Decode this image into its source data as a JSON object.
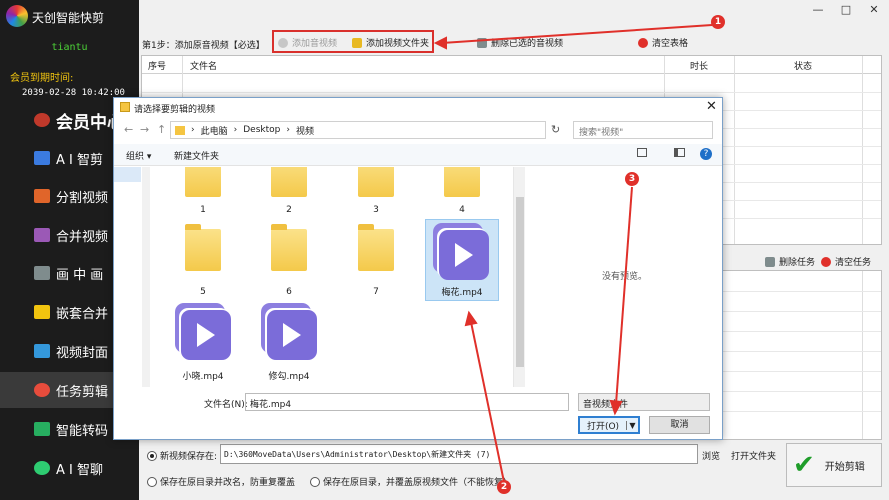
{
  "app": {
    "title": "天创智能快剪",
    "username": "tiantu",
    "expiry_label": "会员到期时间:",
    "expiry_date": "2039-02-28 10:42:00"
  },
  "window": {
    "min": "—",
    "max": "□",
    "close": "✕"
  },
  "sidebar": {
    "items": [
      {
        "label": "会员中心",
        "icon": "member-icon",
        "color": "#ffffff"
      },
      {
        "label": "A I 智剪",
        "icon": "ai-cut-icon",
        "color": "#3b7be0"
      },
      {
        "label": "分割视频",
        "icon": "split-icon",
        "color": "#e0652a"
      },
      {
        "label": "合并视频",
        "icon": "merge-icon",
        "color": "#9b59b6"
      },
      {
        "label": "画 中 画",
        "icon": "pip-icon",
        "color": "#7f8c8d"
      },
      {
        "label": "嵌套合并",
        "icon": "nest-icon",
        "color": "#f1c40f"
      },
      {
        "label": "视频封面",
        "icon": "cover-icon",
        "color": "#3498db"
      },
      {
        "label": "任务剪辑",
        "icon": "task-icon",
        "color": "#e74c3c",
        "active": true
      },
      {
        "label": "智能转码",
        "icon": "transcode-icon",
        "color": "#27ae60"
      },
      {
        "label": "A I 智聊",
        "icon": "ai-chat-icon",
        "color": "#2ecc71"
      }
    ]
  },
  "step1": {
    "label": "第1步：添加原音视频【必选】",
    "add_media": "添加音视频",
    "add_folder": "添加视频文件夹",
    "delete_selected": "删除已选的音视频",
    "clear_table": "清空表格"
  },
  "table": {
    "headers": [
      "序号",
      "文件名",
      "时长",
      "状态"
    ]
  },
  "tasks": {
    "delete_task": "删除任务",
    "clear_tasks": "清空任务"
  },
  "bottom": {
    "save_new_label": "新视频保存在:",
    "save_path": "D:\\360MoveData\\Users\\Administrator\\Desktop\\新建文件夹 (7)",
    "browse": "浏览",
    "open_folder": "打开文件夹",
    "save_rename_label": "保存在原目录并改名，防重复覆盖",
    "save_overwrite_label": "保存在原目录，并覆盖原视频文件（不能恢复）",
    "start": "开始剪辑"
  },
  "dialog": {
    "title": "请选择要剪辑的视频",
    "path": [
      "此电脑",
      "Desktop",
      "视频"
    ],
    "search_placeholder": "搜索\"视频\"",
    "organize": "组织 ▾",
    "new_folder": "新建文件夹",
    "folders": [
      "1",
      "2",
      "3",
      "4",
      "5",
      "6",
      "7"
    ],
    "videos": [
      "梅花.mp4",
      "小晓.mp4",
      "修勾.mp4"
    ],
    "selected": "梅花.mp4",
    "no_preview": "没有预览。",
    "filename_label": "文件名(N):",
    "filename_value": "梅花.mp4",
    "filetype": "音视频文件",
    "open": "打开(O)",
    "cancel": "取消"
  },
  "annotations": {
    "badges": [
      "1",
      "2",
      "3"
    ],
    "color": "#e0302a"
  }
}
